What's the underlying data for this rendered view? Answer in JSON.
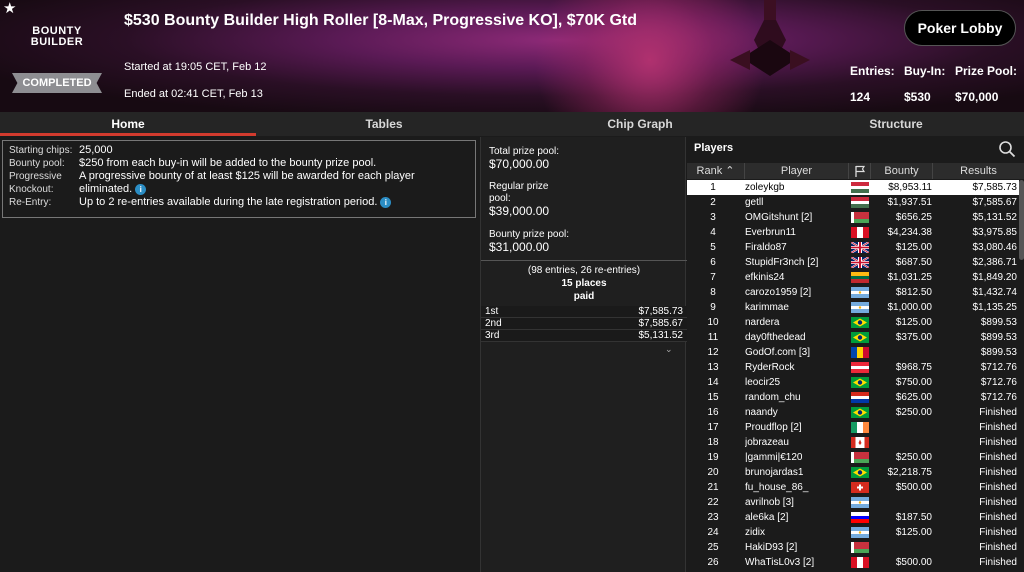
{
  "header": {
    "logo": [
      "BOUNTY",
      "BUILDER"
    ],
    "title": "$530 Bounty Builder High Roller [8-Max, Progressive KO], $70K Gtd",
    "status": "COMPLETED",
    "started": "Started at 19:05 CET, Feb 12",
    "ended": "Ended at 02:41 CET, Feb 13",
    "lobby_button": "Poker Lobby",
    "stats": {
      "entries_label": "Entries:",
      "entries_value": "124",
      "buyin_label": "Buy-In:",
      "buyin_value": "$530",
      "prizepool_label": "Prize Pool:",
      "prizepool_value": "$70,000"
    }
  },
  "tabs": [
    "Home",
    "Tables",
    "Chip Graph",
    "Structure"
  ],
  "info": {
    "starting_chips_label": "Starting chips:",
    "starting_chips": "25,000",
    "bounty_pool_label": "Bounty pool:",
    "bounty_pool": "$250 from each buy-in will be added to the bounty prize pool.",
    "pko_label_1": "Progressive",
    "pko_label_2": "Knockout:",
    "pko_1": "A progressive bounty of at least $125 will be awarded for each player",
    "pko_2": "eliminated.",
    "reentry_label": "Re-Entry:",
    "reentry": "Up to 2 re-entries available during the late registration period."
  },
  "prize": {
    "total_label": "Total prize pool:",
    "total": "$70,000.00",
    "regular_label_1": "Regular prize",
    "regular_label_2": "pool:",
    "regular": "$39,000.00",
    "bounty_label": "Bounty prize pool:",
    "bounty": "$31,000.00",
    "entries_note": "(98 entries, 26 re-entries)",
    "places_1": "15 places",
    "places_2": "paid",
    "places": [
      {
        "pos": "1st",
        "amount": "$7,585.73"
      },
      {
        "pos": "2nd",
        "amount": "$7,585.67"
      },
      {
        "pos": "3rd",
        "amount": "$5,131.52"
      }
    ]
  },
  "players": {
    "title": "Players",
    "columns": {
      "rank": "Rank",
      "player": "Player",
      "bounty": "Bounty",
      "results": "Results"
    },
    "rows": [
      {
        "rank": "1",
        "name": "zoleykgb",
        "flag": "hungary",
        "bounty": "$8,953.11",
        "result": "$7,585.73"
      },
      {
        "rank": "2",
        "name": "getll",
        "flag": "hungary",
        "bounty": "$1,937.51",
        "result": "$7,585.67"
      },
      {
        "rank": "3",
        "name": "OMGitshunt [2]",
        "flag": "belarus",
        "bounty": "$656.25",
        "result": "$5,131.52"
      },
      {
        "rank": "4",
        "name": "Everbrun11",
        "flag": "peru",
        "bounty": "$4,234.38",
        "result": "$3,975.85"
      },
      {
        "rank": "5",
        "name": "Firaldo87",
        "flag": "uk",
        "bounty": "$125.00",
        "result": "$3,080.46"
      },
      {
        "rank": "6",
        "name": "StupidFr3nch [2]",
        "flag": "uk",
        "bounty": "$687.50",
        "result": "$2,386.71"
      },
      {
        "rank": "7",
        "name": "efkinis24",
        "flag": "lithuania",
        "bounty": "$1,031.25",
        "result": "$1,849.20"
      },
      {
        "rank": "8",
        "name": "carozo1959 [2]",
        "flag": "argentina",
        "bounty": "$812.50",
        "result": "$1,432.74"
      },
      {
        "rank": "9",
        "name": "karimmae",
        "flag": "argentina",
        "bounty": "$1,000.00",
        "result": "$1,135.25"
      },
      {
        "rank": "10",
        "name": "nardera",
        "flag": "brazil",
        "bounty": "$125.00",
        "result": "$899.53"
      },
      {
        "rank": "11",
        "name": "day0fthedead",
        "flag": "brazil",
        "bounty": "$375.00",
        "result": "$899.53"
      },
      {
        "rank": "12",
        "name": "GodOf.com [3]",
        "flag": "moldova",
        "bounty": "",
        "result": "$899.53"
      },
      {
        "rank": "13",
        "name": "RyderRock",
        "flag": "austria",
        "bounty": "$968.75",
        "result": "$712.76"
      },
      {
        "rank": "14",
        "name": "leocir25",
        "flag": "brazil",
        "bounty": "$750.00",
        "result": "$712.76"
      },
      {
        "rank": "15",
        "name": "random_chu",
        "flag": "paraguay",
        "bounty": "$625.00",
        "result": "$712.76"
      },
      {
        "rank": "16",
        "name": "naandy",
        "flag": "brazil",
        "bounty": "$250.00",
        "result": "Finished"
      },
      {
        "rank": "17",
        "name": "Proudflop [2]",
        "flag": "ireland",
        "bounty": "",
        "result": "Finished"
      },
      {
        "rank": "18",
        "name": "jobrazeau",
        "flag": "canada",
        "bounty": "",
        "result": "Finished"
      },
      {
        "rank": "19",
        "name": "|gammi|€120",
        "flag": "belarus",
        "bounty": "$250.00",
        "result": "Finished"
      },
      {
        "rank": "20",
        "name": "brunojardas1",
        "flag": "brazil",
        "bounty": "$2,218.75",
        "result": "Finished"
      },
      {
        "rank": "21",
        "name": "fu_house_86_",
        "flag": "switzerland",
        "bounty": "$500.00",
        "result": "Finished"
      },
      {
        "rank": "22",
        "name": "avrilnob [3]",
        "flag": "argentina",
        "bounty": "",
        "result": "Finished"
      },
      {
        "rank": "23",
        "name": "ale6ka [2]",
        "flag": "slovenia",
        "bounty": "$187.50",
        "result": "Finished"
      },
      {
        "rank": "24",
        "name": "zidix",
        "flag": "argentina",
        "bounty": "$125.00",
        "result": "Finished"
      },
      {
        "rank": "25",
        "name": "HakiD93 [2]",
        "flag": "belarus",
        "bounty": "",
        "result": "Finished"
      },
      {
        "rank": "26",
        "name": "WhaTisL0v3 [2]",
        "flag": "peru",
        "bounty": "$500.00",
        "result": "Finished"
      }
    ]
  }
}
